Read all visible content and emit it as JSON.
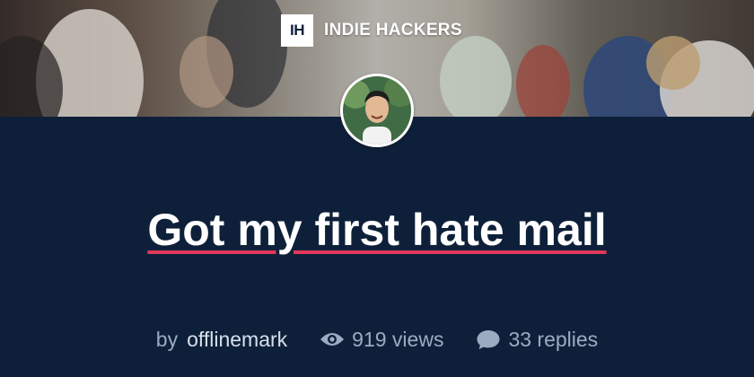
{
  "brand": {
    "mark": "IH",
    "name": "INDIE HACKERS"
  },
  "post": {
    "title": "Got my first hate mail",
    "by_label": "by",
    "author": "offlinemark",
    "views_label": "919 views",
    "replies_label": "33 replies"
  },
  "icons": {
    "views": "eye-icon",
    "replies": "speech-bubble-icon"
  },
  "colors": {
    "background": "#0e2039",
    "title": "#ffffff",
    "title_underline": "#e0385a",
    "meta_text": "#9aabc2",
    "author_text": "#d7e0ec"
  }
}
